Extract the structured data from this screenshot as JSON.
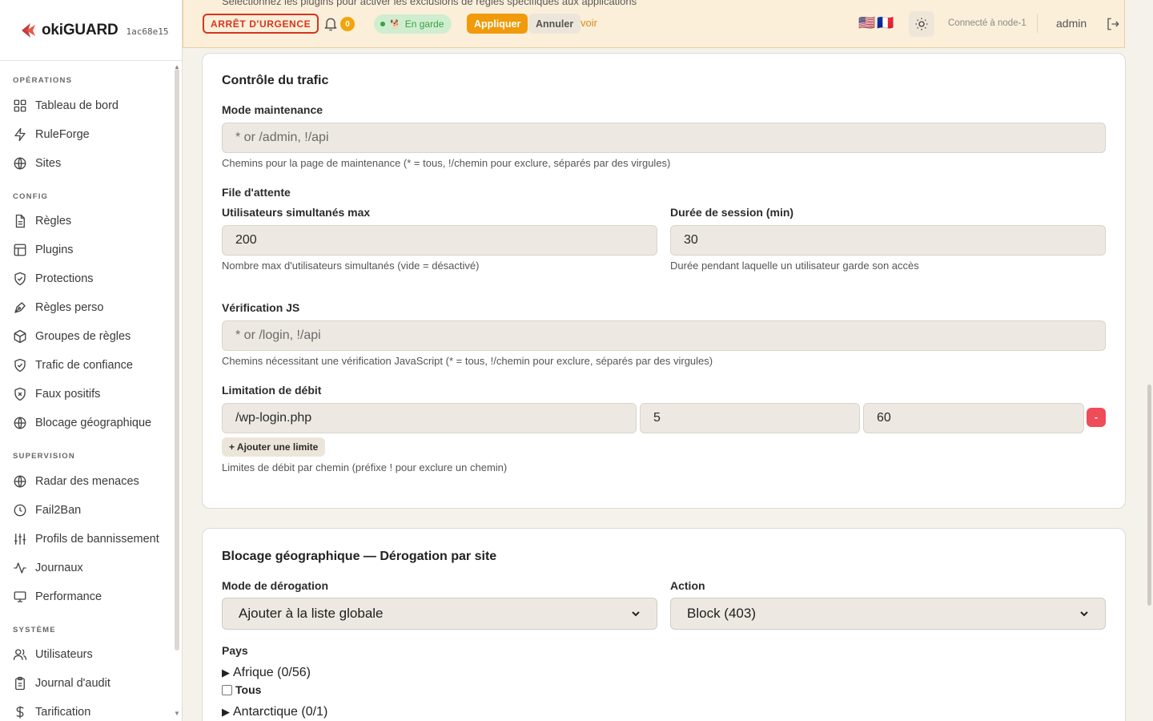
{
  "brand": {
    "name": "okiGUARD",
    "hash": "1ac68e15"
  },
  "sidebar": {
    "sections": [
      {
        "title": "OPÉRATIONS",
        "items": [
          {
            "label": "Tableau de bord",
            "icon": "dashboard-icon"
          },
          {
            "label": "RuleForge",
            "icon": "lightning-icon"
          },
          {
            "label": "Sites",
            "icon": "globe-icon"
          }
        ]
      },
      {
        "title": "CONFIG",
        "items": [
          {
            "label": "Règles",
            "icon": "document-icon"
          },
          {
            "label": "Plugins",
            "icon": "layout-icon"
          },
          {
            "label": "Protections",
            "icon": "shield-check-icon"
          },
          {
            "label": "Règles perso",
            "icon": "pen-tool-icon"
          },
          {
            "label": "Groupes de règles",
            "icon": "package-icon"
          },
          {
            "label": "Trafic de confiance",
            "icon": "shield-check-icon"
          },
          {
            "label": "Faux positifs",
            "icon": "shield-x-icon"
          },
          {
            "label": "Blocage géographique",
            "icon": "globe-icon"
          }
        ]
      },
      {
        "title": "SUPERVISION",
        "items": [
          {
            "label": "Radar des menaces",
            "icon": "globe-icon"
          },
          {
            "label": "Fail2Ban",
            "icon": "clock-icon"
          },
          {
            "label": "Profils de bannissement",
            "icon": "sliders-icon"
          },
          {
            "label": "Journaux",
            "icon": "activity-icon"
          },
          {
            "label": "Performance",
            "icon": "monitor-icon"
          }
        ]
      },
      {
        "title": "SYSTÈME",
        "items": [
          {
            "label": "Utilisateurs",
            "icon": "users-icon"
          },
          {
            "label": "Journal d'audit",
            "icon": "clipboard-icon"
          },
          {
            "label": "Tarification",
            "icon": "dollar-icon"
          }
        ]
      }
    ]
  },
  "topbar": {
    "notice": "Sélectionnez les plugins pour activer les exclusions de règles spécifiques aux applications",
    "emergency_label": "ARRÊT D'URGENCE",
    "notif_count": "0",
    "guard_status": "En garde",
    "apply_label": "Appliquer",
    "cancel_label": "Annuler",
    "see_label": "voir",
    "flags": "🇺🇸🇫🇷",
    "node_status": "Connecté à node-1",
    "user": "admin"
  },
  "traffic": {
    "title": "Contrôle du trafic",
    "maintenance_label": "Mode maintenance",
    "maintenance_placeholder": "* or /admin, !/api",
    "maintenance_help": "Chemins pour la page de maintenance (* = tous, !/chemin pour exclure, séparés par des virgules)",
    "queue_title": "File d'attente",
    "max_users_label": "Utilisateurs simultanés max",
    "max_users_value": "200",
    "max_users_help": "Nombre max d'utilisateurs simultanés (vide = désactivé)",
    "session_label": "Durée de session (min)",
    "session_value": "30",
    "session_help": "Durée pendant laquelle un utilisateur garde son accès",
    "js_label": "Vérification JS",
    "js_placeholder": "* or /login, !/api",
    "js_help": "Chemins nécessitant une vérification JavaScript (* = tous, !/chemin pour exclure, séparés par des virgules)",
    "rate_label": "Limitation de débit",
    "rate_rows": [
      {
        "path": "/wp-login.php",
        "requests": "5",
        "window": "60"
      }
    ],
    "remove_label": "-",
    "add_label": "+ Ajouter une limite",
    "rate_help": "Limites de débit par chemin (préfixe ! pour exclure un chemin)"
  },
  "geo": {
    "title": "Blocage géographique — Dérogation par site",
    "mode_label": "Mode de dérogation",
    "mode_value": "Ajouter à la liste globale",
    "action_label": "Action",
    "action_value": "Block (403)",
    "countries_label": "Pays",
    "regions": [
      {
        "label": "Afrique (0/56)"
      },
      {
        "label": "Antarctique (0/1)"
      }
    ],
    "all_label": "Tous"
  }
}
